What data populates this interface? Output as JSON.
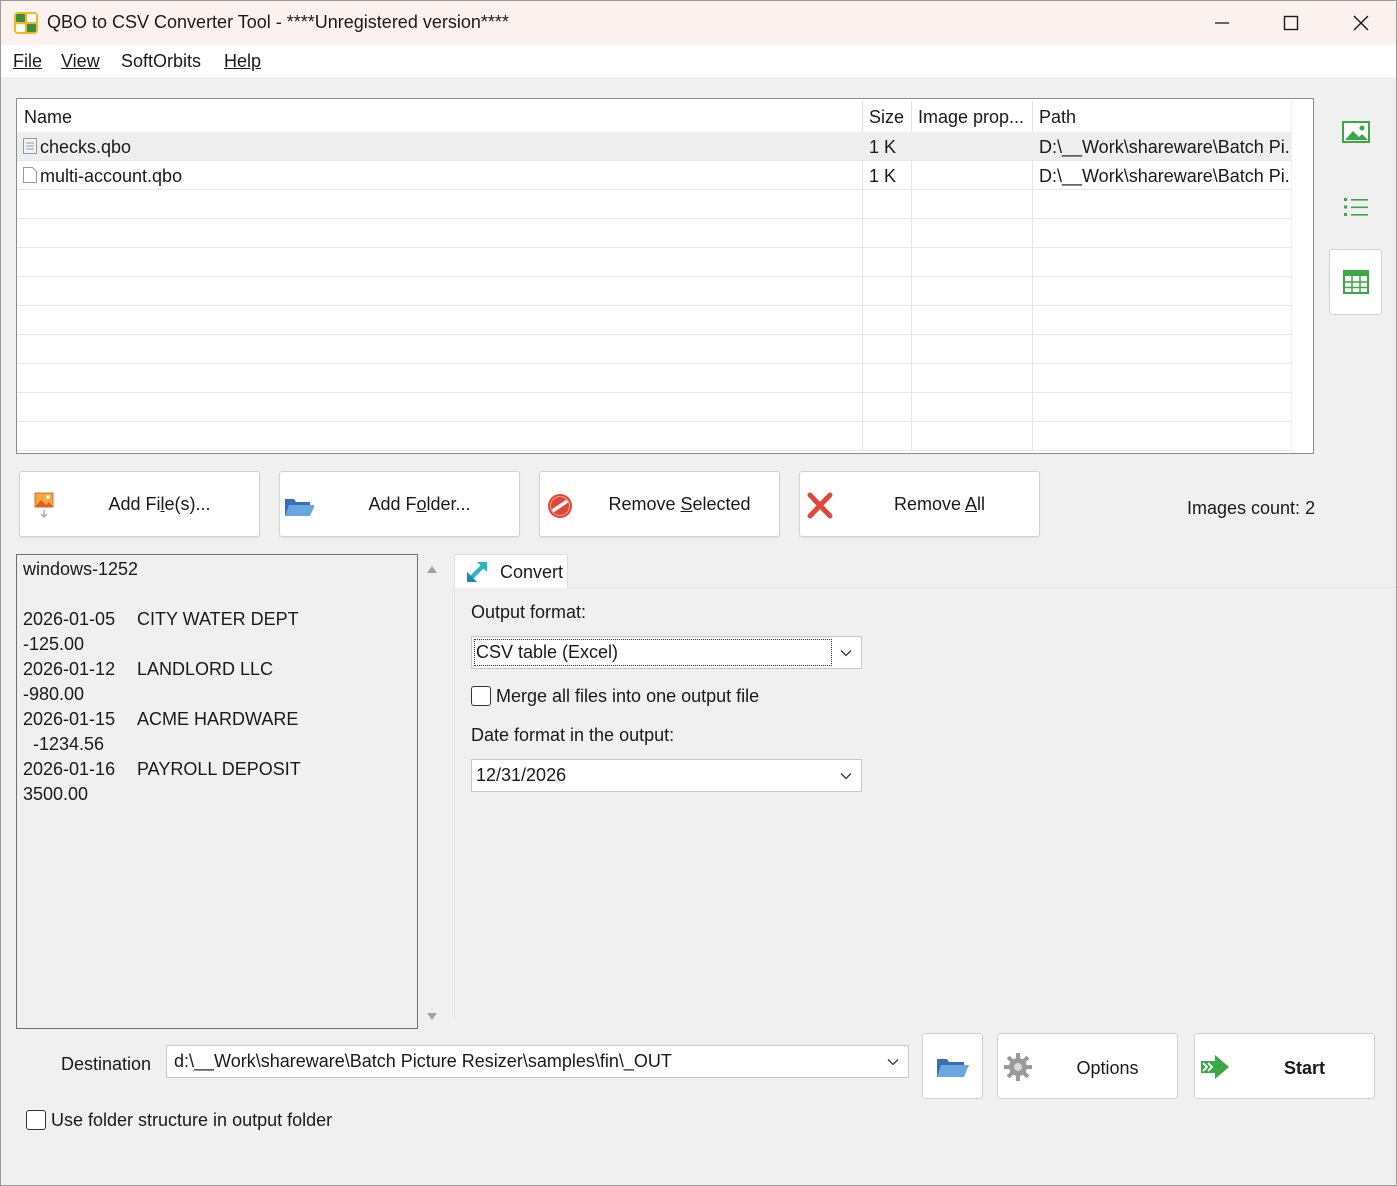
{
  "window": {
    "title": "QBO to CSV Converter Tool - ****Unregistered version****",
    "icon": "app-icon"
  },
  "menu": {
    "file": "File",
    "view": "View",
    "softorbits": "SoftOrbits",
    "help": "Help"
  },
  "file_list": {
    "columns": [
      "Name",
      "Size",
      "Image prop...",
      "Path"
    ],
    "rows": [
      {
        "name": "checks.qbo",
        "size": "1 K",
        "image_prop": "",
        "path": "D:\\__Work\\shareware\\Batch Pi..."
      },
      {
        "name": "multi-account.qbo",
        "size": "1 K",
        "image_prop": "",
        "path": "D:\\__Work\\shareware\\Batch Pi..."
      }
    ]
  },
  "side_icons": [
    "image-view-icon",
    "list-view-icon",
    "table-view-icon"
  ],
  "actions": {
    "add_files_pre": "Add Fi",
    "add_files_ul": "l",
    "add_files_post": "e(s)...",
    "add_folder_pre": "Add F",
    "add_folder_ul": "o",
    "add_folder_post": "lder...",
    "remove_selected_pre": "Remove ",
    "remove_selected_ul": "S",
    "remove_selected_post": "elected",
    "remove_all_pre": "Remove ",
    "remove_all_ul": "A",
    "remove_all_post": "ll",
    "images_count": "Images count: 2"
  },
  "preview": {
    "encoding": "windows-1252",
    "transactions": [
      {
        "date": "2026-01-05",
        "payee": "CITY WATER DEPT",
        "amount": "-125.00"
      },
      {
        "date": "2026-01-12",
        "payee": "LANDLORD LLC",
        "amount": "-980.00"
      },
      {
        "date": "2026-01-15",
        "payee": "ACME HARDWARE",
        "amount": "  -1234.56"
      },
      {
        "date": "2026-01-16",
        "payee": "PAYROLL DEPOSIT",
        "amount": "3500.00"
      }
    ]
  },
  "convert": {
    "tab_label": "Convert",
    "output_format_label": "Output format:",
    "output_format_value": "CSV table (Excel)",
    "merge_label": "Merge all files into one output file",
    "merge_checked": false,
    "date_format_label": "Date format in the output:",
    "date_format_value": "12/31/2026"
  },
  "destination": {
    "label": "Destination",
    "path": "d:\\__Work\\shareware\\Batch Picture Resizer\\samples\\fin\\_OUT",
    "options_label": "Options",
    "start_label": "Start",
    "use_folder_structure_label": "Use folder structure in output folder",
    "use_folder_structure_checked": false
  },
  "colors": {
    "title_bg": "#fbf1ee",
    "accent_green": "#3aa845",
    "remove_red": "#e2463a",
    "icon_blue": "#1e9ad6"
  }
}
